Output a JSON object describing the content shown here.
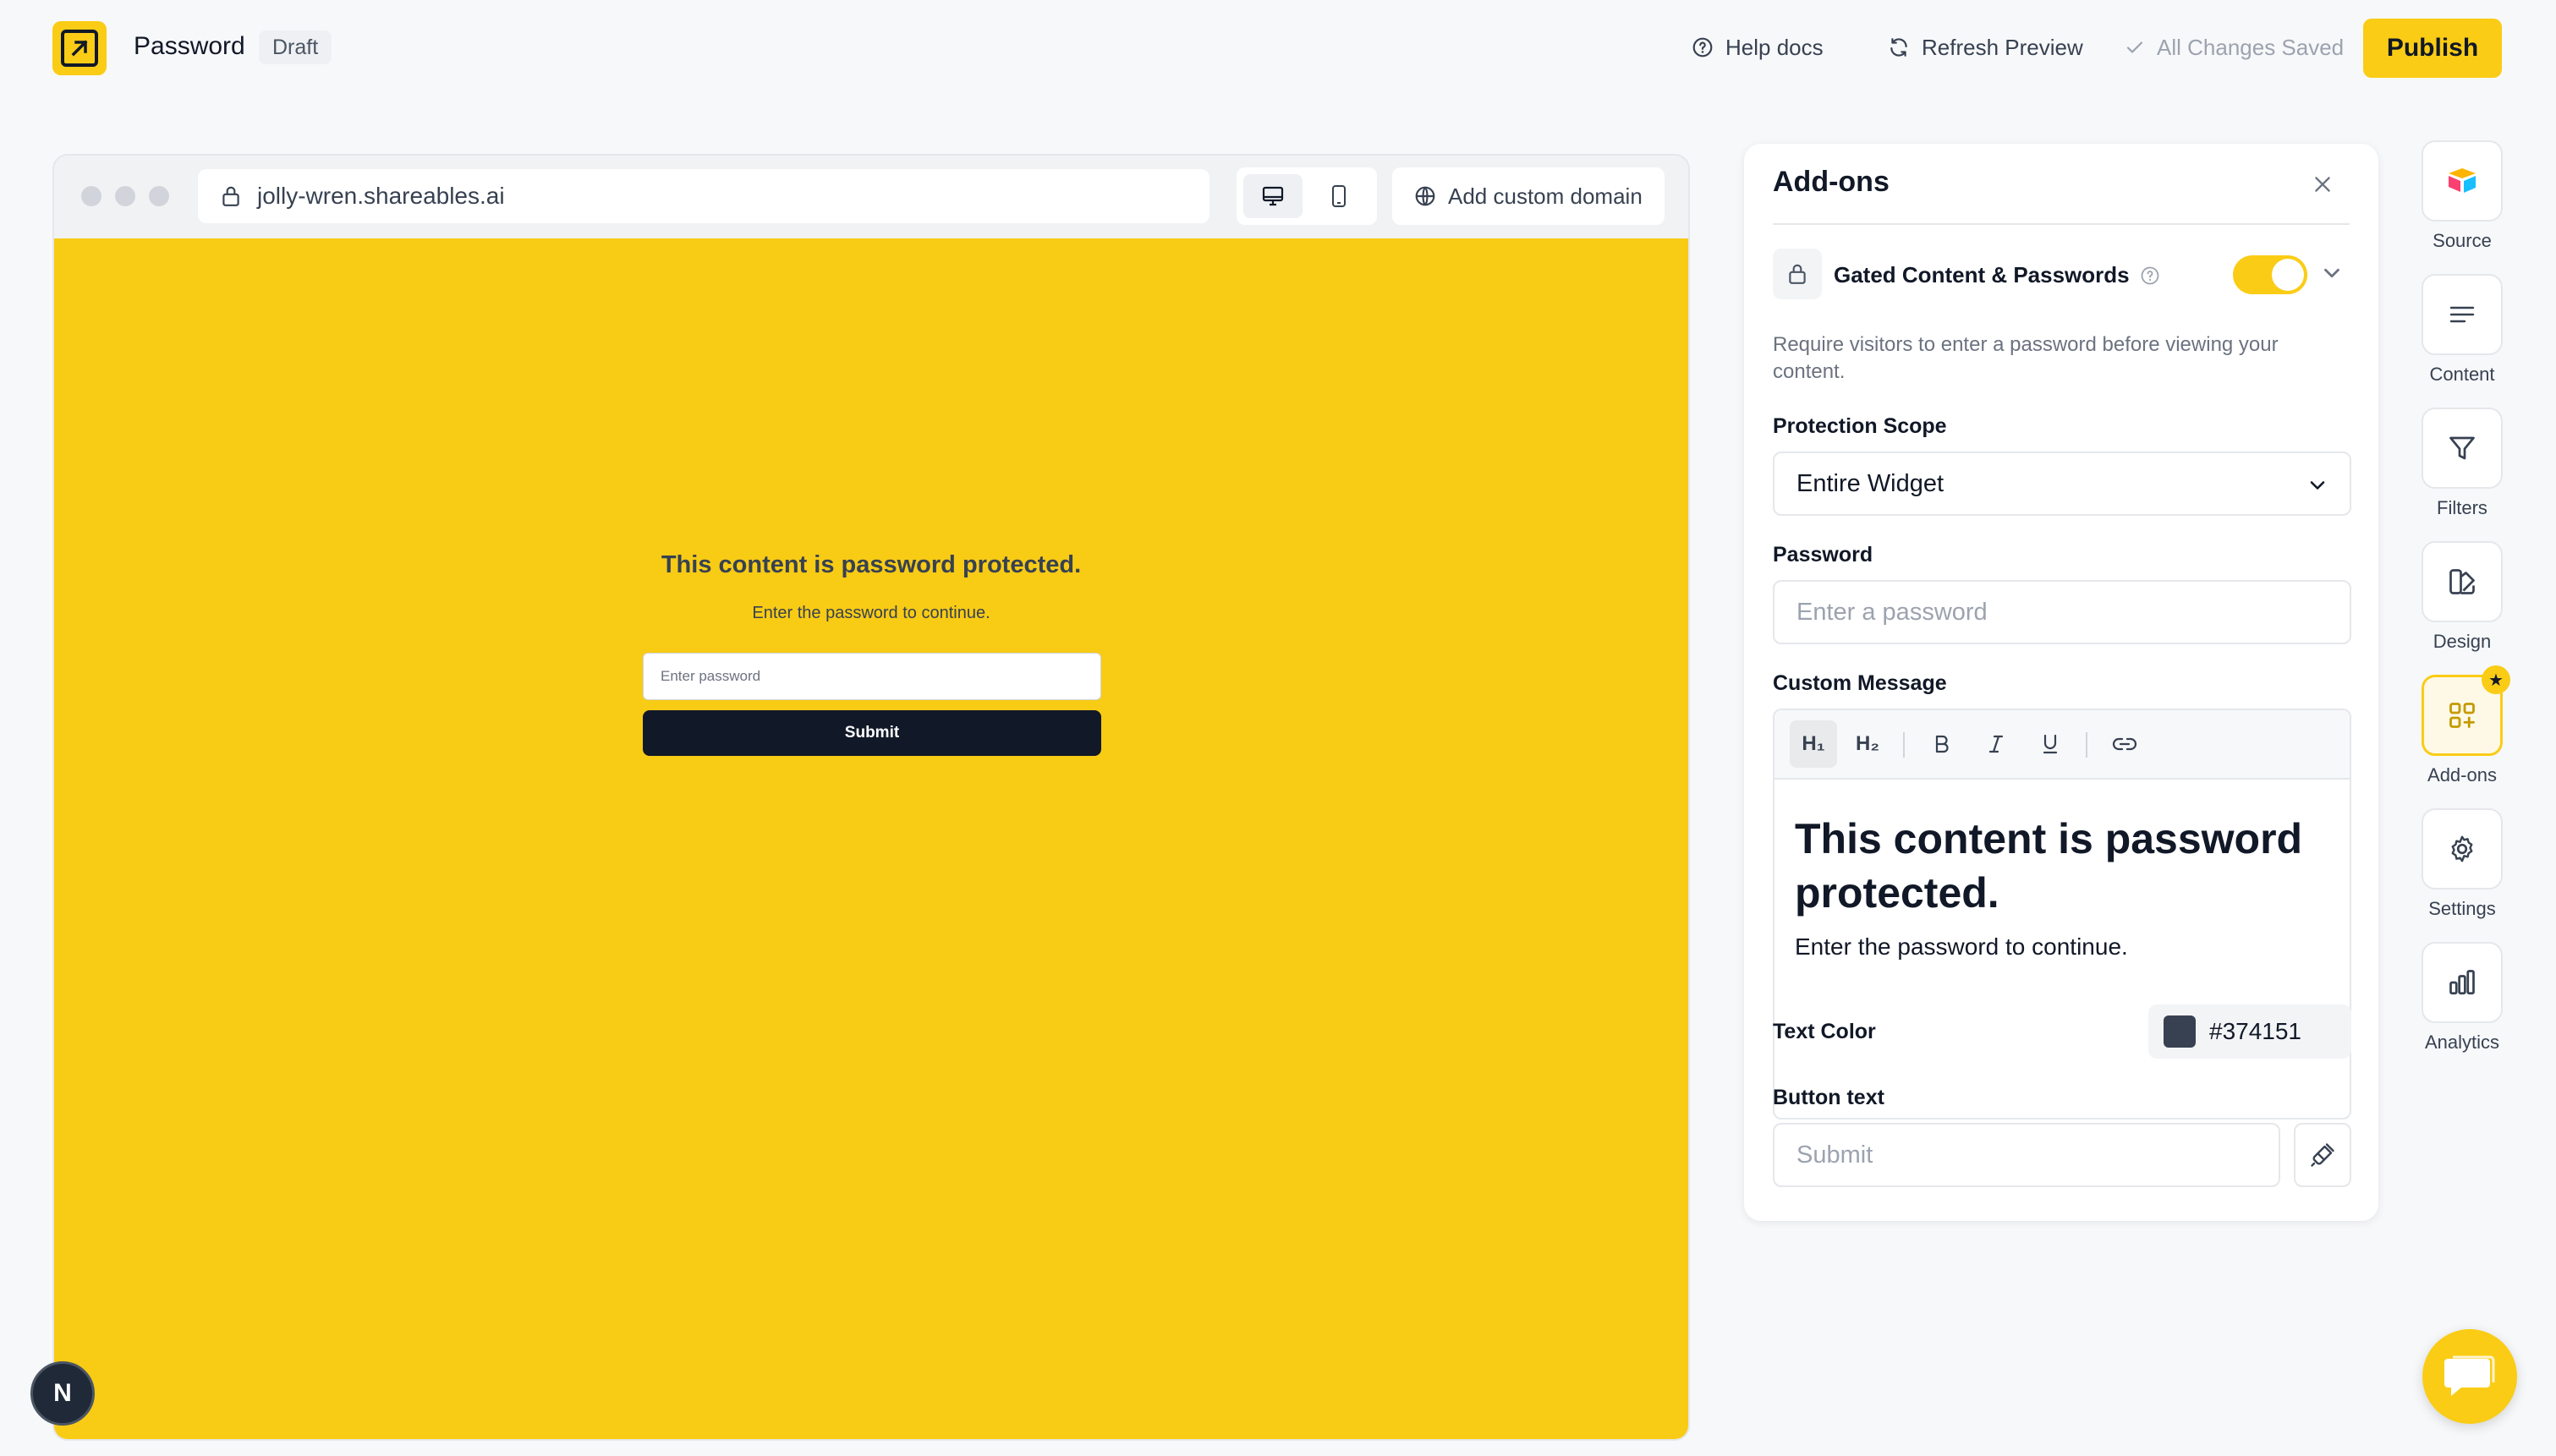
{
  "header": {
    "title": "Password",
    "status_badge": "Draft",
    "help_label": "Help docs",
    "refresh_label": "Refresh Preview",
    "saved_label": "All Changes Saved",
    "publish_label": "Publish"
  },
  "browser": {
    "url": "jolly-wren.shareables.ai",
    "custom_domain_label": "Add custom domain",
    "active_device": "desktop"
  },
  "preview": {
    "title": "This content is password protected.",
    "subtitle": "Enter the password to continue.",
    "input_placeholder": "Enter password",
    "submit_label": "Submit",
    "background_color": "#f8cb15",
    "text_color": "#374151"
  },
  "addons": {
    "title": "Add-ons",
    "gated": {
      "label": "Gated Content & Passwords",
      "enabled": true,
      "description": "Require visitors to enter a password before viewing your content."
    },
    "protection_scope": {
      "label": "Protection Scope",
      "value": "Entire Widget"
    },
    "password": {
      "label": "Password",
      "placeholder": "Enter a password",
      "value": ""
    },
    "custom_message": {
      "label": "Custom Message",
      "toolbar": {
        "h1": "H₁",
        "h2": "H₂",
        "bold": "B",
        "italic": "I",
        "underline": "U"
      },
      "heading": "This content is password protected.",
      "body": "Enter the password to continue."
    },
    "text_color": {
      "label": "Text Color",
      "value": "#374151"
    },
    "button_text": {
      "label": "Button text",
      "placeholder": "Submit"
    }
  },
  "rail": [
    {
      "label": "Source",
      "icon": "airtable-icon"
    },
    {
      "label": "Content",
      "icon": "lines-icon"
    },
    {
      "label": "Filters",
      "icon": "filter-icon"
    },
    {
      "label": "Design",
      "icon": "design-icon"
    },
    {
      "label": "Add-ons",
      "icon": "addons-icon",
      "active": true
    },
    {
      "label": "Settings",
      "icon": "gear-icon"
    },
    {
      "label": "Analytics",
      "icon": "bar-chart-icon"
    }
  ],
  "floating": {
    "n_badge": "N"
  },
  "colors": {
    "accent": "#facc15",
    "preview_bg": "#f8cb15",
    "dark": "#111827"
  }
}
